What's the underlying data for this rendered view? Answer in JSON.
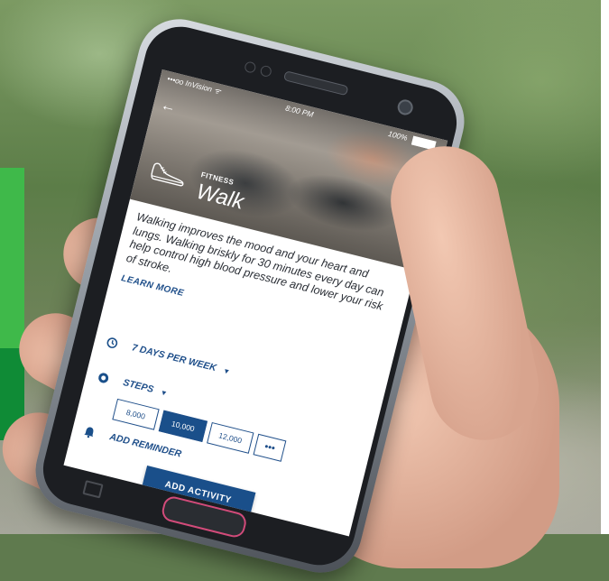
{
  "status": {
    "carrier": "•••oo InVision ᯤ",
    "time": "8:00 PM",
    "battery": "100%"
  },
  "activity": {
    "category": "FITNESS",
    "title": "Walk",
    "description": "Walking improves the mood and your heart and lungs. Walking briskly for 30 minutes every day can help control high blood pressure and lower your risk of stroke.",
    "learn_more": "LEARN MORE"
  },
  "frequency": {
    "value": "7 DAYS PER WEEK",
    "icon": "clock-icon"
  },
  "metric": {
    "value": "STEPS",
    "icon": "target-icon"
  },
  "step_options": [
    {
      "label": "8,000",
      "selected": false
    },
    {
      "label": "10,000",
      "selected": true
    },
    {
      "label": "12,000",
      "selected": false
    },
    {
      "label": "•••",
      "selected": false
    }
  ],
  "reminder": {
    "label": "ADD REMINDER",
    "icon": "bell-icon"
  },
  "cta": {
    "label": "ADD ACTIVITY"
  },
  "colors": {
    "brand_blue": "#1a4f8a",
    "green_light": "#3fb94a",
    "green_dark": "#0f8b36"
  }
}
